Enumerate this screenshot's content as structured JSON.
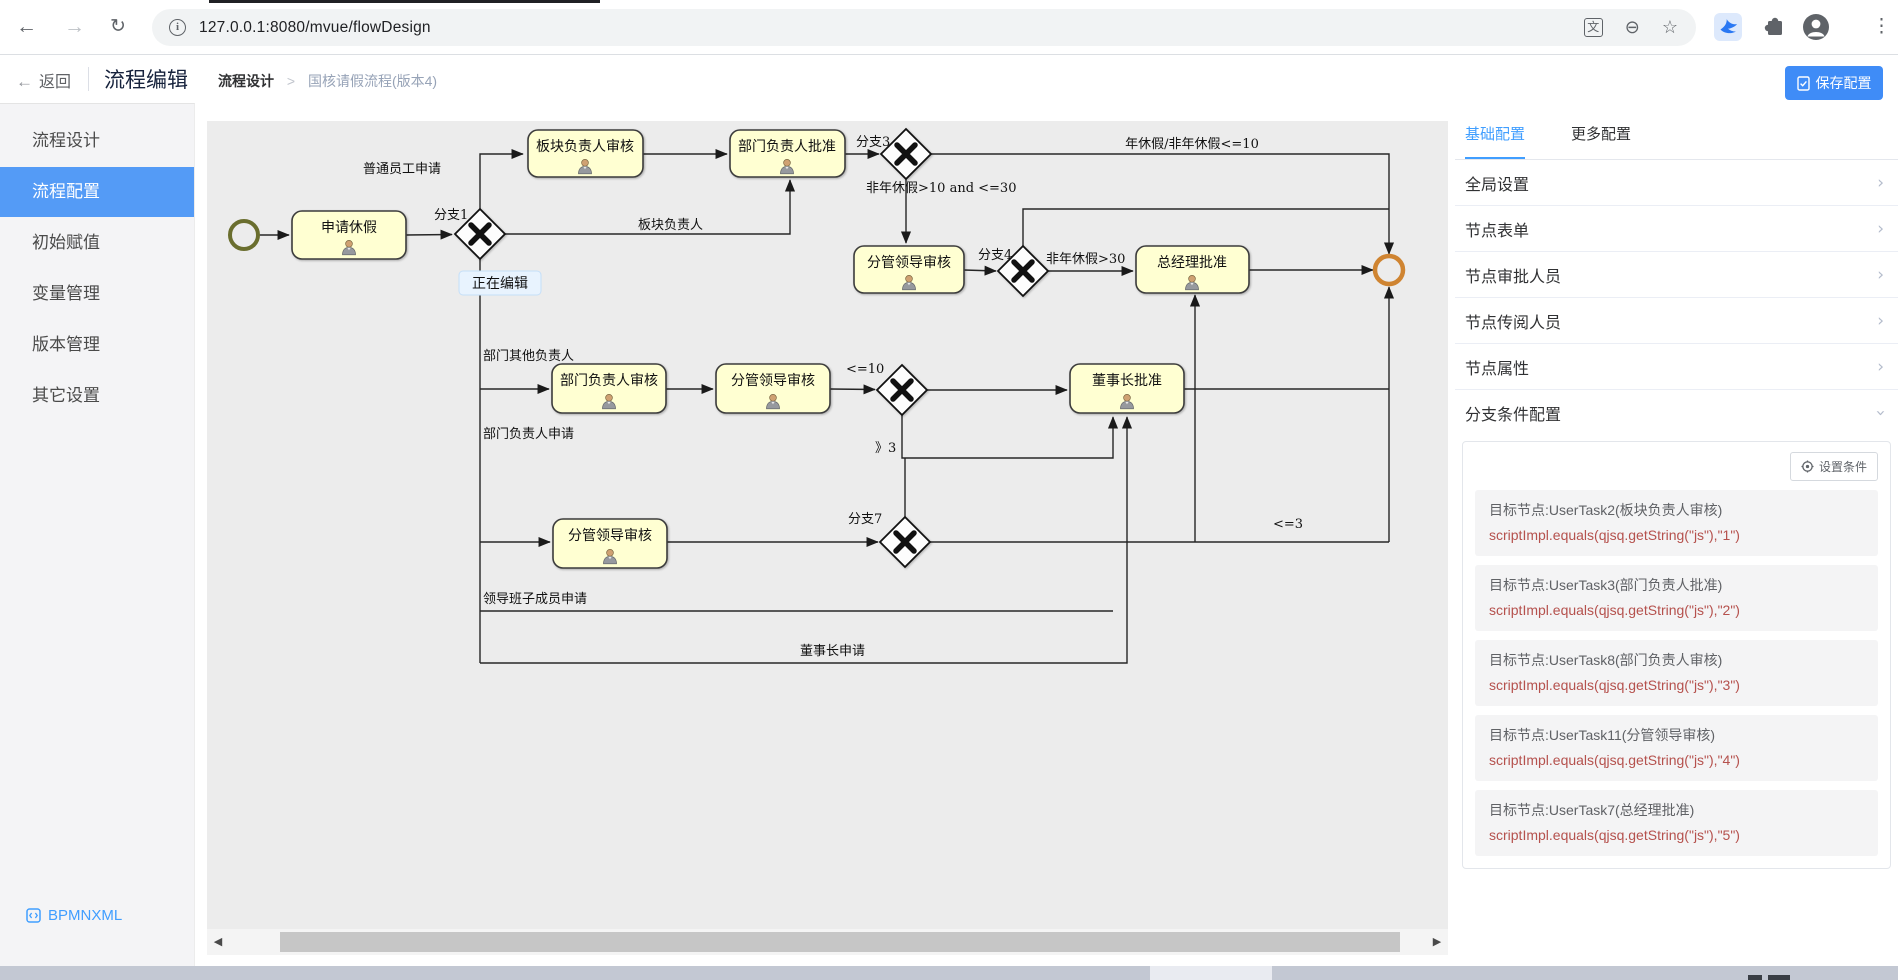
{
  "browser": {
    "url": "127.0.0.1:8080/mvue/flowDesign"
  },
  "header": {
    "back": "返回",
    "title": "流程编辑",
    "crumb_root": "流程设计",
    "crumb_sep": ">",
    "crumb_current": "国核请假流程(版本4)",
    "save": "保存配置"
  },
  "sidebar": {
    "items": [
      "流程设计",
      "流程配置",
      "初始赋值",
      "变量管理",
      "版本管理",
      "其它设置"
    ],
    "bpmn": "BPMNXML"
  },
  "diagram": {
    "editing": "正在编辑",
    "tasks": [
      "申请休假",
      "板块负责人审核",
      "部门负责人批准",
      "分管领导审核",
      "总经理批准",
      "部门负责人审核",
      "分管领导审核",
      "董事长批准",
      "分管领导审核"
    ],
    "labels": [
      "普通员工申请",
      "分支1",
      "板块负责人",
      "分支3",
      "年休假/非年休假<=10",
      "非年休假>10 and <=30",
      "分支4",
      "非年休假>30",
      "部门其他负责人",
      "部门负责人申请",
      "<=10",
      "》3",
      "分支7",
      "<=3",
      "领导班子成员申请",
      "董事长申请"
    ]
  },
  "panel": {
    "tabs": [
      "基础配置",
      "更多配置"
    ],
    "sections": [
      "全局设置",
      "节点表单",
      "节点审批人员",
      "节点传阅人员",
      "节点属性",
      "分支条件配置"
    ],
    "set_condition": "设置条件",
    "conditions": [
      {
        "target": "目标节点:UserTask2(板块负责人审核)",
        "script": "scriptImpl.equals(qjsq.getString(\"js\"),\"1\")"
      },
      {
        "target": "目标节点:UserTask3(部门负责人批准)",
        "script": "scriptImpl.equals(qjsq.getString(\"js\"),\"2\")"
      },
      {
        "target": "目标节点:UserTask8(部门负责人审核)",
        "script": "scriptImpl.equals(qjsq.getString(\"js\"),\"3\")"
      },
      {
        "target": "目标节点:UserTask11(分管领导审核)",
        "script": "scriptImpl.equals(qjsq.getString(\"js\"),\"4\")"
      },
      {
        "target": "目标节点:UserTask7(总经理批准)",
        "script": "scriptImpl.equals(qjsq.getString(\"js\"),\"5\")"
      }
    ]
  },
  "colors": {
    "accent": "#409eff",
    "sidebar_active": "#549bf6",
    "task_fill": "#ffffd2",
    "start_stroke": "#6a6e2e",
    "end_stroke": "#cf8431",
    "script_red": "#b5514d",
    "canvas_bg": "#ececec"
  }
}
